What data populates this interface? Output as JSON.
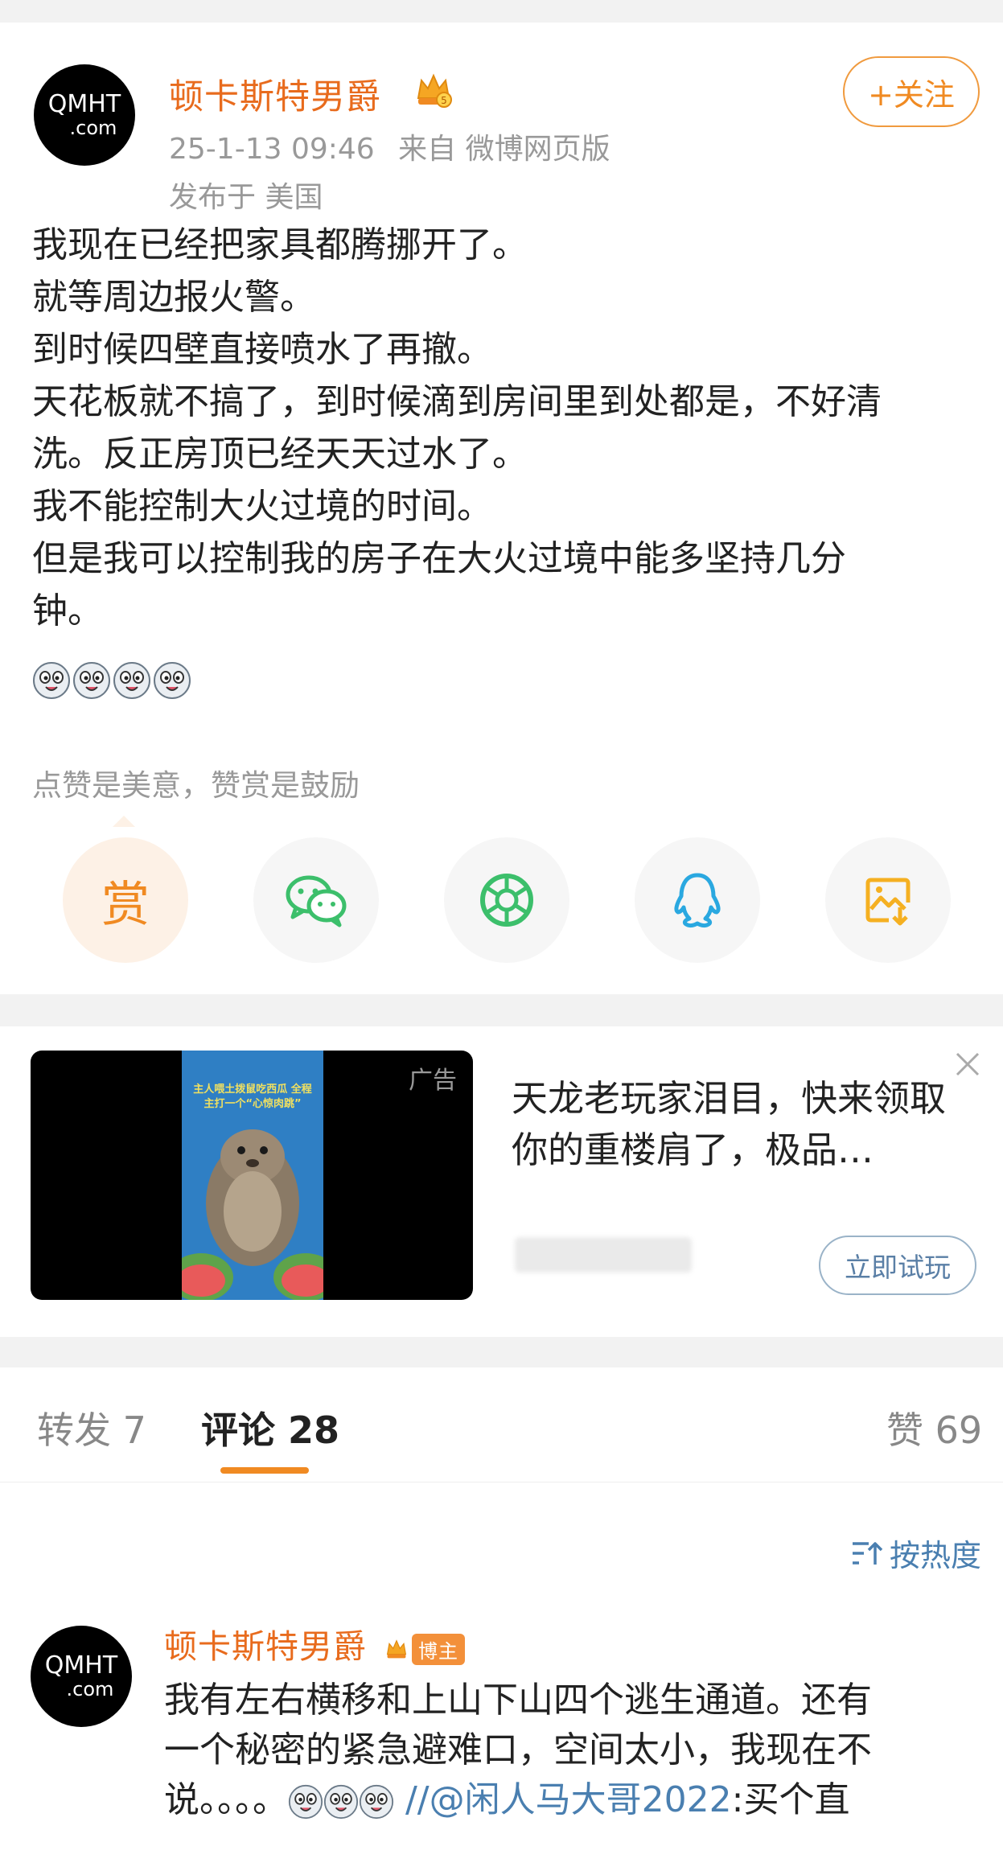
{
  "post": {
    "avatar_line1": "QMHT",
    "avatar_line2": ".com",
    "author": "顿卡斯特男爵",
    "timestamp": "25-1-13 09:46",
    "source": "来自 微博网页版",
    "location": "发布于 美国",
    "follow_label": "+关注",
    "lines": [
      "我现在已经把家具都腾挪开了。",
      "就等周边报火警。",
      "到时候四壁直接喷水了再撤。",
      "天花板就不搞了，到时候滴到房间里到处都是，不好清",
      "洗。反正房顶已经天天过水了。",
      "我不能控制大火过境的时间。",
      "但是我可以控制我的房子在大火过境中能多坚持几分",
      "钟。"
    ],
    "emoji": "doge-emoji",
    "emoji_count": 4,
    "reward_tip": "点赞是美意，赞赏是鼓励",
    "reward_glyph": "赏",
    "share_icons": [
      "reward-icon",
      "wechat-icon",
      "moments-icon",
      "qq-icon",
      "save-image-icon"
    ]
  },
  "ad": {
    "label": "广告",
    "video_caption": "主人喂土拨鼠吃西瓜 全程主打一个“心惊肉跳”",
    "title": "天龙老玩家泪目，快来领取你的重楼肩了，极品…",
    "button": "立即试玩"
  },
  "tabs": {
    "repost": "转发 7",
    "comments": "评论 28",
    "likes": "赞 69"
  },
  "comments": {
    "sort_label": "按热度",
    "items": [
      {
        "avatar_line1": "QMHT",
        "avatar_line2": ".com",
        "author": "顿卡斯特男爵",
        "badge": "博主",
        "line1": "我有左右横移和上山下山四个逃生通道。还有",
        "line2": "一个秘密的紧急避难口，空间太小，我现在不",
        "line3_prefix": "说。。。。",
        "line3_sep": " //",
        "mention": "@闲人马大哥2022",
        "line3_suffix": ":买个直"
      }
    ]
  },
  "colors": {
    "accent": "#f08a22",
    "username": "#e86b1d",
    "link": "#4a7fb0",
    "meta": "#999999"
  }
}
